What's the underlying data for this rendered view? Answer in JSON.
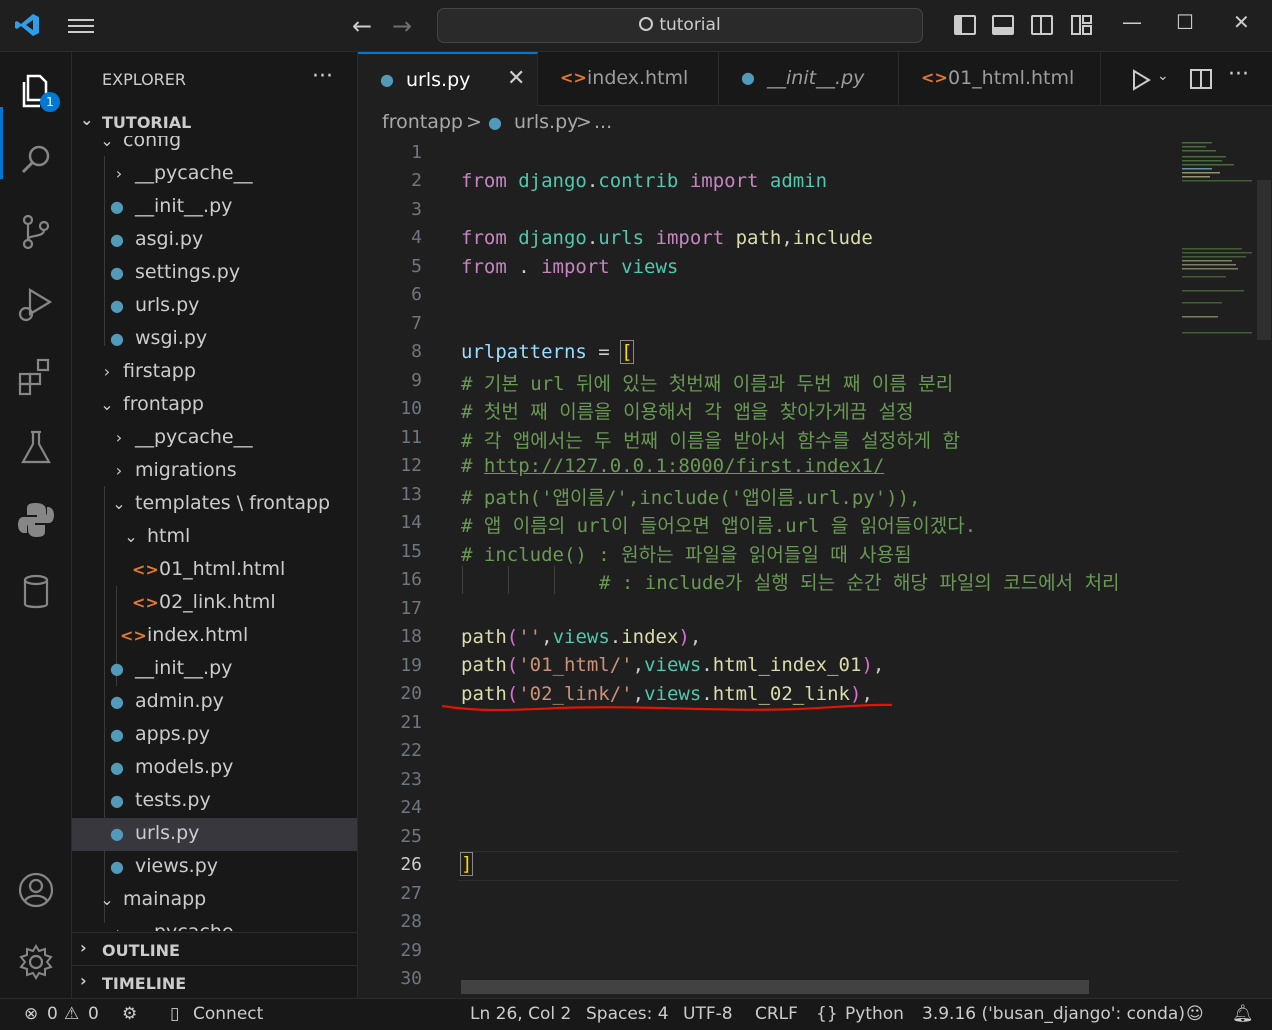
{
  "titlebar": {
    "search_text": "tutorial",
    "back_arrow": "←",
    "forward_arrow": "→",
    "minimize": "—",
    "maximize": "☐",
    "close": "✕"
  },
  "activity_bar": {
    "explorer_badge": "1",
    "icons": [
      "explorer-icon",
      "search-icon",
      "source-control-icon",
      "run-debug-icon",
      "extensions-icon",
      "testing-icon",
      "python-icon",
      "database-icon",
      "account-icon",
      "settings-gear-icon"
    ]
  },
  "sidebar": {
    "title": "EXPLORER",
    "more": "···",
    "workspace": "TUTORIAL",
    "outline": "OUTLINE",
    "timeline": "TIMELINE",
    "tree": [
      {
        "label": "config",
        "type": "folder",
        "expanded": true
      },
      {
        "label": "__pycache__",
        "type": "folder",
        "expanded": false
      },
      {
        "label": "__init__.py",
        "type": "python"
      },
      {
        "label": "asgi.py",
        "type": "python"
      },
      {
        "label": "settings.py",
        "type": "python"
      },
      {
        "label": "urls.py",
        "type": "python"
      },
      {
        "label": "wsgi.py",
        "type": "python"
      },
      {
        "label": "firstapp",
        "type": "folder",
        "expanded": false
      },
      {
        "label": "frontapp",
        "type": "folder",
        "expanded": true
      },
      {
        "label": "__pycache__",
        "type": "folder",
        "expanded": false
      },
      {
        "label": "migrations",
        "type": "folder",
        "expanded": false
      },
      {
        "label": "templates \\ frontapp",
        "type": "folder",
        "expanded": true
      },
      {
        "label": "html",
        "type": "folder",
        "expanded": true
      },
      {
        "label": "01_html.html",
        "type": "html"
      },
      {
        "label": "02_link.html",
        "type": "html"
      },
      {
        "label": "index.html",
        "type": "html"
      },
      {
        "label": "__init__.py",
        "type": "python"
      },
      {
        "label": "admin.py",
        "type": "python"
      },
      {
        "label": "apps.py",
        "type": "python"
      },
      {
        "label": "models.py",
        "type": "python"
      },
      {
        "label": "tests.py",
        "type": "python"
      },
      {
        "label": "urls.py",
        "type": "python",
        "selected": true
      },
      {
        "label": "views.py",
        "type": "python"
      },
      {
        "label": "mainapp",
        "type": "folder",
        "expanded": true
      },
      {
        "label": "__pycache__",
        "type": "folder",
        "expanded": false
      }
    ]
  },
  "tabs": [
    {
      "label": "urls.py",
      "icon": "python-file-icon",
      "active": true
    },
    {
      "label": "index.html",
      "icon": "html-file-icon"
    },
    {
      "label": "__init__.py",
      "icon": "python-file-icon",
      "italic": true
    },
    {
      "label": "01_html.html",
      "icon": "html-file-icon"
    }
  ],
  "breadcrumb": {
    "folder": "frontapp",
    "sep": ">",
    "file": "urls.py",
    "more": "..."
  },
  "editor": {
    "current_line": 26,
    "line_numbers": [
      "1",
      "2",
      "3",
      "4",
      "5",
      "6",
      "7",
      "8",
      "9",
      "10",
      "11",
      "12",
      "13",
      "14",
      "15",
      "16",
      "17",
      "18",
      "19",
      "20",
      "21",
      "22",
      "23",
      "24",
      "25",
      "26",
      "27",
      "28",
      "29",
      "30"
    ],
    "code": {
      "l2": [
        "from",
        " django",
        ".",
        "contrib",
        " import",
        " admin"
      ],
      "l4": [
        "from",
        " django",
        ".",
        "urls",
        " import",
        " path",
        ",",
        "include"
      ],
      "l5": [
        "from",
        " . ",
        "import",
        " views"
      ],
      "l8": [
        "urlpatterns",
        " = ",
        "["
      ],
      "l9": "# 기본 url 뒤에 있는 첫번째 이름과 두번 째 이름 분리",
      "l10": "# 첫번 째 이름을 이용해서 각 앱을 찾아가게끔 설정",
      "l11": "# 각 앱에서는 두 번째 이름을 받아서 함수를 설정하게 함",
      "l12_prefix": "# ",
      "l12_link": "http://127.0.0.1:8000/first.index1/",
      "l13": "# path('앱이름/',include('앱이름.url.py')),",
      "l14": "# 앱 이름의 url이 들어오면 앱이름.url 을 읽어들이겠다.",
      "l15": "# include() : 원하는 파일을 읽어들일 때 사용됨",
      "l16": "# : include가 실행 되는 순간 해당 파일의 코드에서 처리",
      "l18": [
        "path",
        "(",
        "''",
        ",",
        "views",
        ".",
        "index",
        ")",
        ","
      ],
      "l19": [
        "path",
        "(",
        "'01_html/'",
        ",",
        "views",
        ".",
        "html_index_01",
        ")",
        ","
      ],
      "l20": [
        "path",
        "(",
        "'02_link/'",
        ",",
        "views",
        ".",
        "html_02_link",
        ")",
        ","
      ],
      "l26": "]"
    }
  },
  "statusbar": {
    "errors": "0",
    "warnings": "0",
    "connect": "Connect",
    "position": "Ln 26, Col 2",
    "spaces": "Spaces: 4",
    "encoding": "UTF-8",
    "eol": "CRLF",
    "language": "Python",
    "interpreter": "3.9.16 ('busan_django': conda)"
  },
  "colors": {
    "accent": "#0078d4",
    "keyword": "#c586c0",
    "module": "#4ec9b0",
    "comment": "#6a9955",
    "string": "#ce9178",
    "annotation_underline": "#e51400"
  }
}
